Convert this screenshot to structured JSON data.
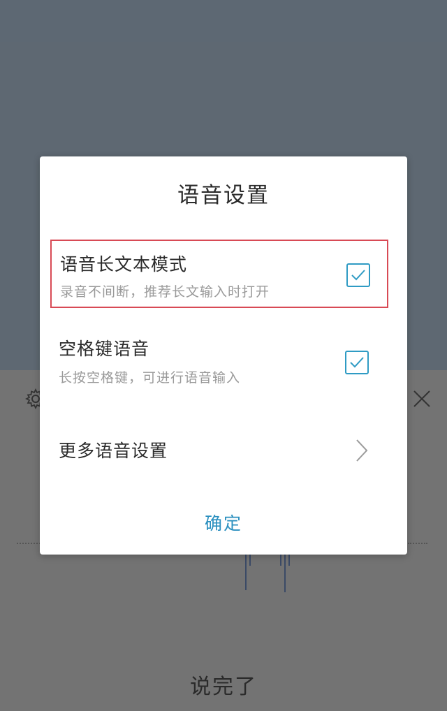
{
  "dialog": {
    "title": "语音设置",
    "options": [
      {
        "title": "语音长文本模式",
        "subtitle": "录音不间断，推荐长文输入时打开",
        "checked": true
      },
      {
        "title": "空格键语音",
        "subtitle": "长按空格键，可进行语音输入",
        "checked": true
      }
    ],
    "more": {
      "title": "更多语音设置"
    },
    "confirm_label": "确定"
  },
  "voice_panel": {
    "done_label": "说完了"
  },
  "icons": {
    "settings": "gear-icon",
    "close": "close-icon",
    "check": "checkmark-icon",
    "chevron": "chevron-right-icon"
  },
  "colors": {
    "accent": "#2f9bc4",
    "highlight_border": "#d84a55",
    "overlay": "#6b6f74"
  }
}
